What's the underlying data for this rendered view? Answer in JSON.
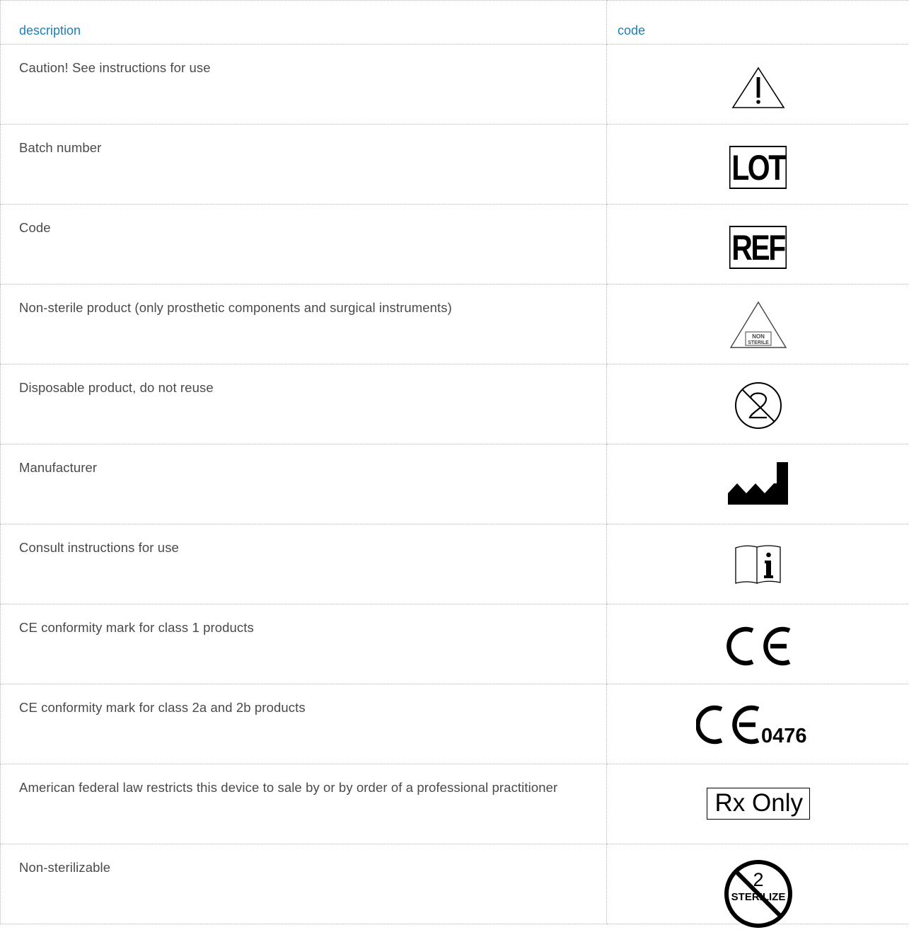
{
  "table": {
    "headers": {
      "description": "description",
      "code": "code"
    },
    "rows": [
      {
        "description": "Caution! See instructions for use",
        "symbol": "caution-warning-icon"
      },
      {
        "description": "Batch number",
        "symbol": "lot-symbol",
        "symbol_text": "LOT"
      },
      {
        "description": "Code",
        "symbol": "ref-symbol",
        "symbol_text": "REF"
      },
      {
        "description": "Non-sterile product (only prosthetic components and surgical instruments)",
        "symbol": "non-sterile-icon",
        "symbol_text": [
          "NON",
          "STERILE"
        ]
      },
      {
        "description": "Disposable product, do not reuse",
        "symbol": "do-not-reuse-icon"
      },
      {
        "description": "Manufacturer",
        "symbol": "manufacturer-icon"
      },
      {
        "description": "Consult instructions for use",
        "symbol": "consult-instructions-icon"
      },
      {
        "description": "CE conformity mark for class 1 products",
        "symbol": "ce-mark-icon"
      },
      {
        "description": "CE conformity mark for class 2a and 2b products",
        "symbol": "ce-mark-0476-icon",
        "symbol_text": "0476"
      },
      {
        "description": "American federal law restricts this device to sale by or by order of a professional practitioner",
        "symbol": "rx-only-symbol",
        "symbol_text": "Rx Only"
      },
      {
        "description": "Non-sterilizable",
        "symbol": "do-not-resterilize-icon",
        "symbol_text": "STERILIZE"
      }
    ]
  },
  "colors": {
    "header_text": "#1b7fbe",
    "body_text": "#4a4a4a",
    "rule": "#b4b4b4",
    "symbol": "#000000"
  }
}
